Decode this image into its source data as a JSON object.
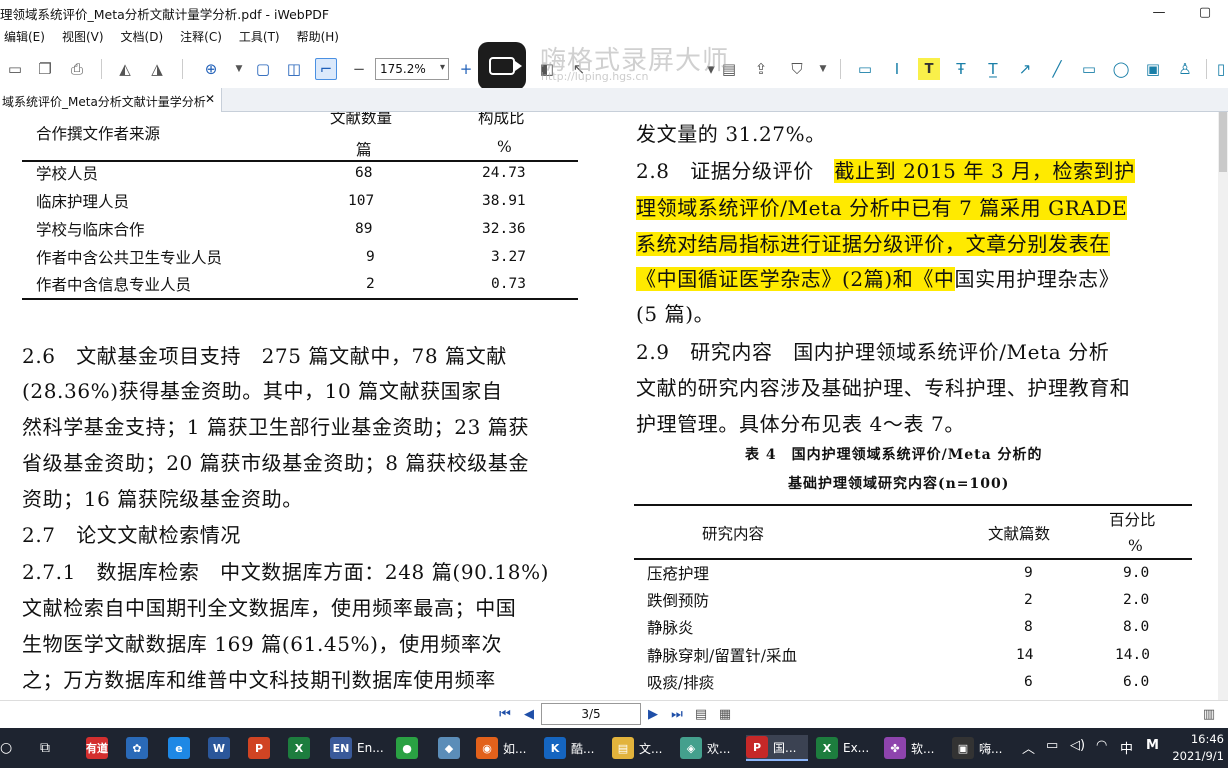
{
  "window": {
    "title": "理领域系统评价_Meta分析文献计量学分析.pdf - iWebPDF",
    "minimize": "—",
    "restore": "▢"
  },
  "menu": [
    "编辑(E)",
    "视图(V)",
    "文档(D)",
    "注释(C)",
    "工具(T)",
    "帮助(H)"
  ],
  "toolbar": {
    "zoom_value": "175.2%"
  },
  "recorder_watermark": {
    "title": "嗨格式录屏大师",
    "url": "http://luping.hgs.cn"
  },
  "tab": {
    "label": "域系统评价_Meta分析文献计量学分析",
    "close": "✕"
  },
  "table_top": {
    "header_col1": "合作撰文作者来源",
    "header_col2_line1": "文献数量",
    "header_col2_line2": "篇",
    "header_col3_line1": "构成比",
    "header_col3_line2": "%",
    "rows": [
      {
        "label": "学校人员",
        "count": "68",
        "pct": "24.73"
      },
      {
        "label": "临床护理人员",
        "count": "107",
        "pct": "38.91"
      },
      {
        "label": "学校与临床合作",
        "count": "89",
        "pct": "32.36"
      },
      {
        "label": "作者中含公共卫生专业人员",
        "count": "9",
        "pct": "3.27"
      },
      {
        "label": "作者中含信息专业人员",
        "count": "2",
        "pct": "0.73"
      }
    ]
  },
  "left_text": [
    "2.6　文献基金项目支持　275 篇文献中，78 篇文献",
    "(28.36%)获得基金资助。其中，10 篇文献获国家自",
    "然科学基金支持；1 篇获卫生部行业基金资助；23 篇获",
    "省级基金资助；20 篇获市级基金资助；8 篇获校级基金",
    "资助；16 篇获院级基金资助。",
    "2.7　论文文献检索情况",
    "2.7.1　数据库检索　中文数据库方面：248 篇(90.18%)",
    "文献检索自中国期刊全文数据库，使用频率最高；中国",
    "生物医学文献数据库 169 篇(61.45%)，使用频率次",
    "之；万方数据库和维普中文科技期刊数据库使用频率"
  ],
  "right_text": {
    "line0": "发文量的 31.27%。",
    "line1_plain": "2.8　证据分级评价　",
    "line1_hl": "截止到 2015 年 3 月，检索到护",
    "line2_hl": "理领域系统评价/Meta 分析中已有 7 篇采用 GRADE",
    "line3_hl": "系统对结局指标进行证据分级评价，文章分别发表在",
    "line4_hl": "《中国循证医学杂志》(2篇)和《中",
    "line4_plain": "国实用护理杂志》",
    "line5": "(5 篇)。",
    "line6": "2.9　研究内容　国内护理领域系统评价/Meta 分析",
    "line7": "文献的研究内容涉及基础护理、专科护理、护理教育和",
    "line8": "护理管理。具体分布见表 4～表 7。"
  },
  "table4": {
    "caption1": "表 4　国内护理领域系统评价/Meta 分析的",
    "caption2": "基础护理领域研究内容(n=100)",
    "header_col1": "研究内容",
    "header_col2": "文献篇数",
    "header_col3_line1": "百分比",
    "header_col3_line2": "%",
    "rows": [
      {
        "label": "压疮护理",
        "count": "9",
        "pct": "9.0"
      },
      {
        "label": "跌倒预防",
        "count": "2",
        "pct": "2.0"
      },
      {
        "label": "静脉炎",
        "count": "8",
        "pct": "8.0"
      },
      {
        "label": "静脉穿刺/留置针/采血",
        "count": "14",
        "pct": "14.0"
      },
      {
        "label": "吸痰/排痰",
        "count": "6",
        "pct": "6.0"
      }
    ]
  },
  "nav": {
    "page": "3/5"
  },
  "taskbar": {
    "items": [
      {
        "label": "",
        "icon": "有道",
        "color": "#d32f2f"
      },
      {
        "label": "",
        "icon": "✿",
        "color": "#2a6ab8"
      },
      {
        "label": "",
        "icon": "e",
        "color": "#1e88e5"
      },
      {
        "label": "",
        "icon": "W",
        "color": "#2b579a"
      },
      {
        "label": "",
        "icon": "P",
        "color": "#d04423"
      },
      {
        "label": "",
        "icon": "X",
        "color": "#1d7d3e"
      },
      {
        "label": "En...",
        "icon": "EN",
        "color": "#3a5a9a"
      },
      {
        "label": "",
        "icon": "●",
        "color": "#2aa143"
      },
      {
        "label": "",
        "icon": "◆",
        "color": "#5b8db8"
      },
      {
        "label": "如...",
        "icon": "◉",
        "color": "#e2611b"
      },
      {
        "label": "酷...",
        "icon": "K",
        "color": "#1565c0"
      },
      {
        "label": "文...",
        "icon": "▤",
        "color": "#e2b33c"
      },
      {
        "label": "欢...",
        "icon": "◈",
        "color": "#44a08d"
      },
      {
        "label": "国...",
        "icon": "P",
        "color": "#c62828"
      },
      {
        "label": "Ex...",
        "icon": "X",
        "color": "#1d7d3e"
      },
      {
        "label": "软...",
        "icon": "✤",
        "color": "#8e44ad"
      },
      {
        "label": "嗨...",
        "icon": "▣",
        "color": "#333333"
      }
    ],
    "ime": "中",
    "ime2": "M",
    "time": "16:46",
    "date": "2021/9/1"
  }
}
